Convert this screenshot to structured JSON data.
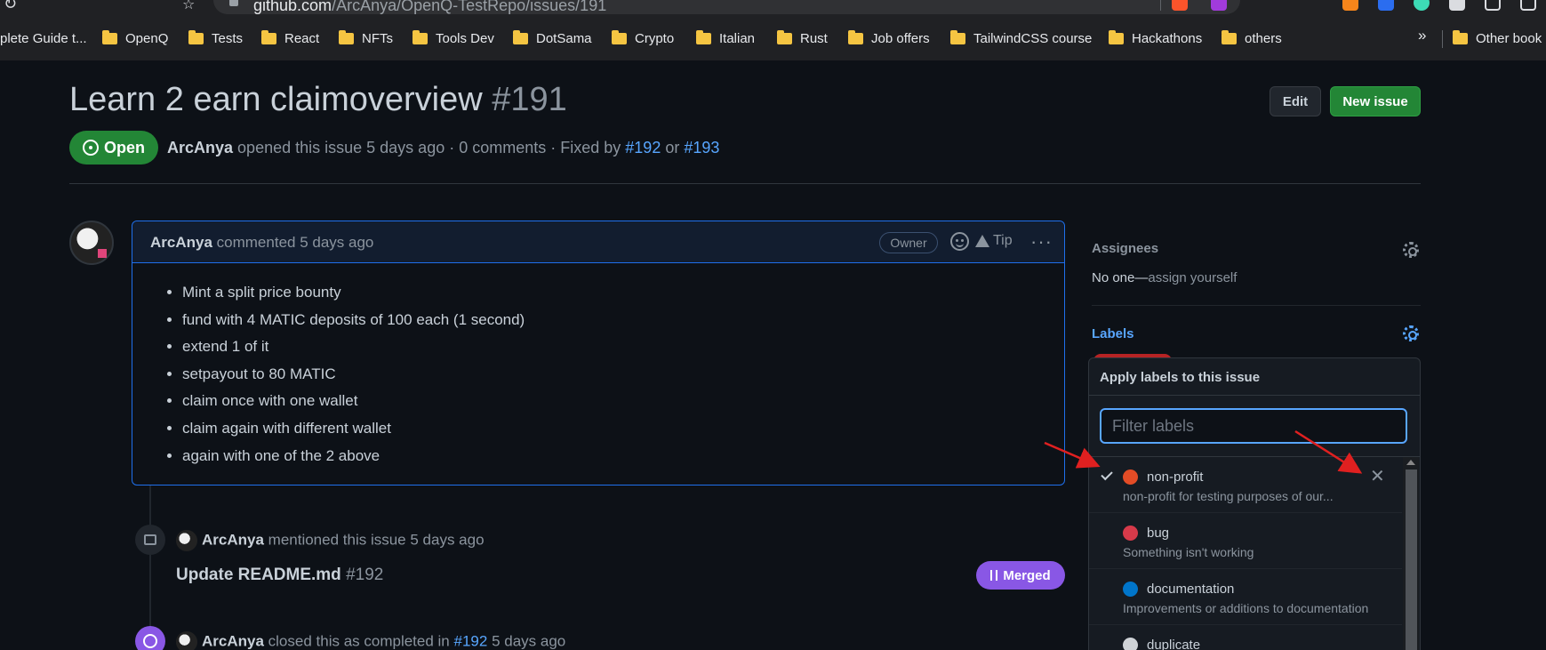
{
  "browser": {
    "url_host": "github.com",
    "url_path": "/ArcAnya/OpenQ-TestRepo/issues/191",
    "bookmarks": [
      "plete Guide t...",
      "OpenQ",
      "Tests",
      "React",
      "NFTs",
      "Tools Dev",
      "DotSama",
      "Crypto",
      "Italian",
      "Rust",
      "Job offers",
      "TailwindCSS course",
      "Hackathons",
      "others"
    ],
    "more": "»",
    "other_bookmarks": "Other book"
  },
  "issue": {
    "title": "Learn 2 earn claimoverview",
    "number": "#191",
    "edit_label": "Edit",
    "new_issue_label": "New issue",
    "state": "Open",
    "meta": {
      "author": "ArcAnya",
      "opened": "opened this issue 5 days ago · 0 comments · Fixed by",
      "fix1": "#192",
      "or": "or",
      "fix2": "#193"
    }
  },
  "comment": {
    "author": "ArcAnya",
    "time": "commented 5 days ago",
    "role": "Owner",
    "tip": "Tip",
    "items": [
      "Mint a split price bounty",
      "fund with 4 MATIC deposits of 100 each (1 second)",
      "extend 1 of it",
      "setpayout to 80 MATIC",
      "claim once with one wallet",
      "claim again with different wallet",
      "again with one of the 2 above"
    ]
  },
  "timeline": {
    "mention": {
      "author": "ArcAnya",
      "text": "mentioned this issue 5 days ago",
      "ref_title": "Update README.md",
      "ref_num": "#192",
      "status": "Merged"
    },
    "closed": {
      "author": "ArcAnya",
      "text": "closed this as completed in",
      "ref": "#192",
      "time": "5 days ago"
    }
  },
  "sidebar": {
    "assignees": {
      "heading": "Assignees",
      "none": "No one—",
      "assign": "assign yourself"
    },
    "labels": {
      "heading": "Labels",
      "dropdown_title": "Apply labels to this issue",
      "filter_placeholder": "Filter labels",
      "options": [
        {
          "name": "non-profit",
          "desc": "non-profit for testing purposes of our...",
          "color": "#e34c26",
          "selected": true
        },
        {
          "name": "bug",
          "desc": "Something isn't working",
          "color": "#d73a4a",
          "selected": false
        },
        {
          "name": "documentation",
          "desc": "Improvements or additions to documentation",
          "color": "#0075ca",
          "selected": false
        },
        {
          "name": "duplicate",
          "desc": "",
          "color": "#cfd3d7",
          "selected": false
        }
      ]
    }
  },
  "colors": {
    "accent": "#58a6ff",
    "green": "#238636",
    "purple": "#8957e5",
    "annotation_arrow": "#e02020"
  }
}
